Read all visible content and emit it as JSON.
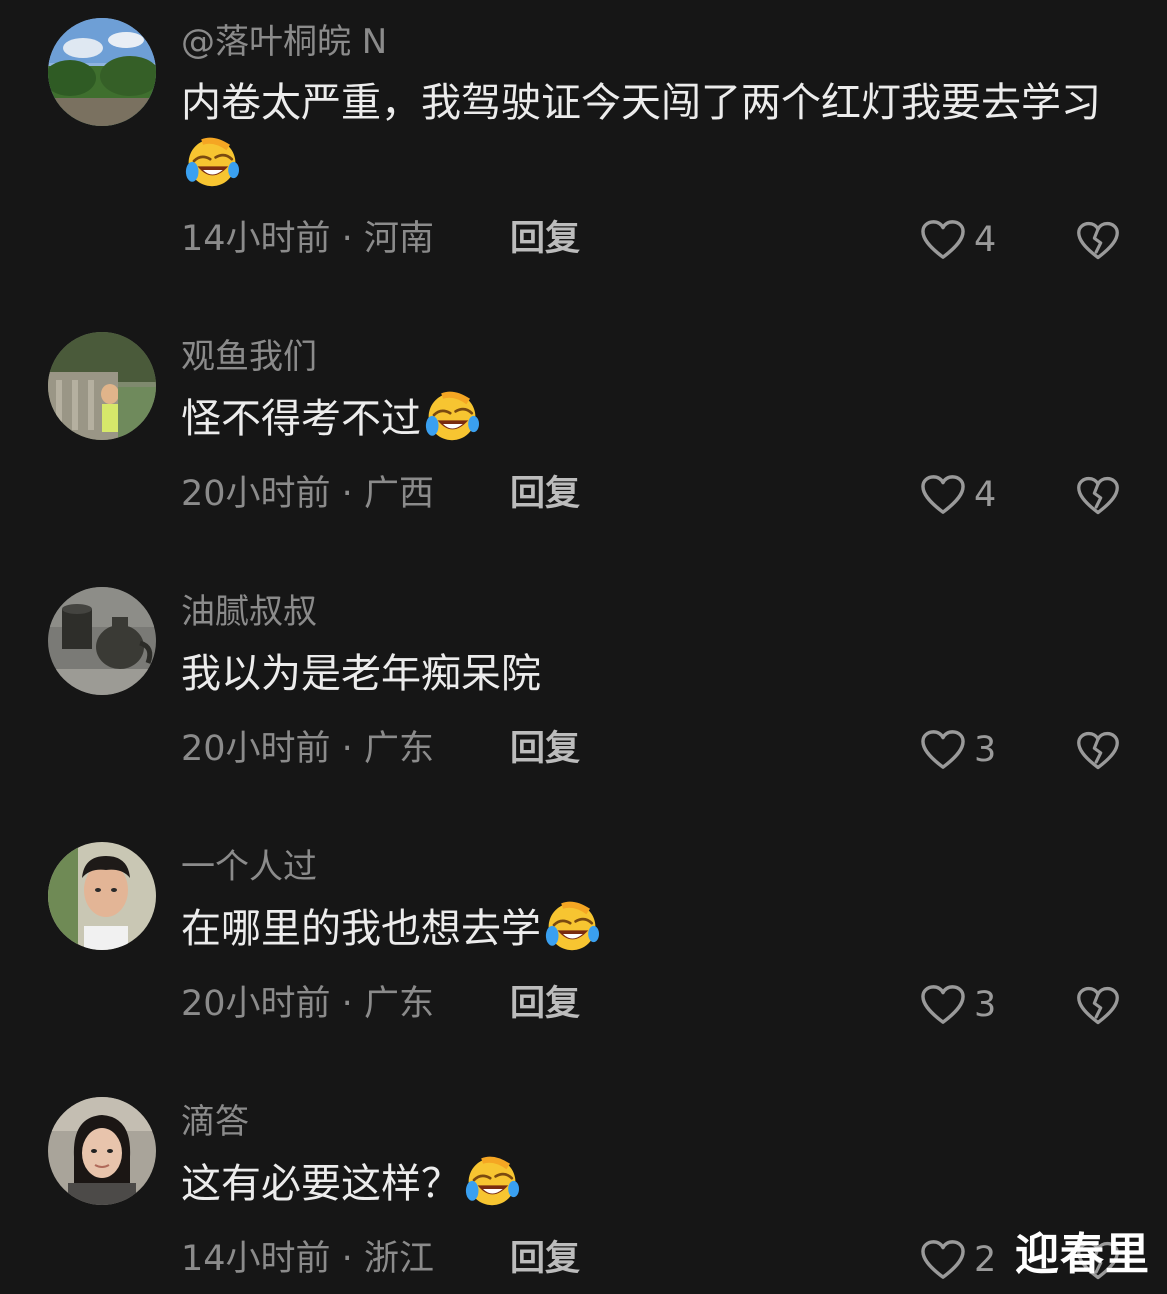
{
  "comments": [
    {
      "username": "@落叶桐皖 N",
      "text": "内卷太严重，我驾驶证今天闯了两个红灯我要去学习",
      "emoji": "laughing-crying-emoji",
      "time": "14小时前",
      "location": "河南",
      "reply_label": "回复",
      "likes": "4"
    },
    {
      "username": "观鱼我们",
      "text": "怪不得考不过",
      "emoji": "laughing-crying-emoji",
      "time": "20小时前",
      "location": "广西",
      "reply_label": "回复",
      "likes": "4"
    },
    {
      "username": "油腻叔叔",
      "text": "我以为是老年痴呆院",
      "time": "20小时前",
      "location": "广东",
      "reply_label": "回复",
      "likes": "3"
    },
    {
      "username": "一个人过",
      "text": "在哪里的我也想去学",
      "emoji": "laughing-crying-emoji",
      "time": "20小时前",
      "location": "广东",
      "reply_label": "回复",
      "likes": "3"
    },
    {
      "username": "滴答",
      "text": "这有必要这样？",
      "emoji": "laughing-crying-emoji",
      "time": "14小时前",
      "location": "浙江",
      "reply_label": "回复",
      "likes": "2"
    }
  ],
  "meta_separator": " · ",
  "watermark": "迎春里",
  "colors": {
    "background": "#161616",
    "text_primary": "#ececec",
    "text_secondary": "#8b8b8b"
  }
}
